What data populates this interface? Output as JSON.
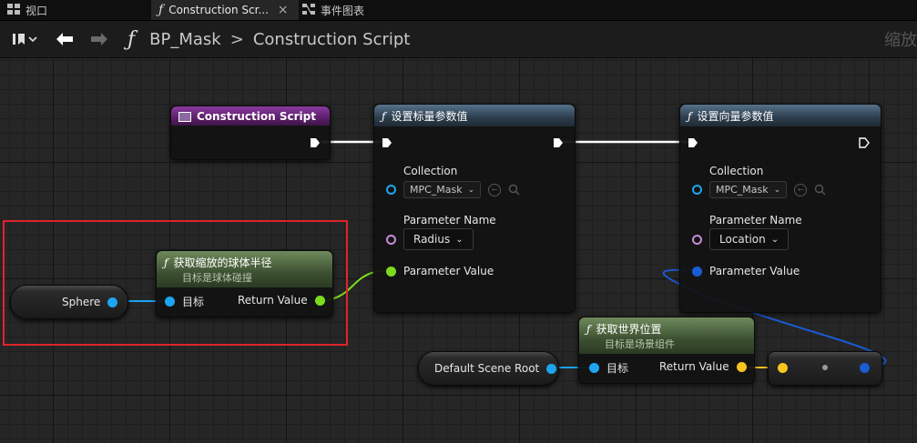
{
  "tabs": [
    {
      "label": "视口",
      "icon": "viewport-grid-icon"
    },
    {
      "label": "Construction Scr...",
      "icon": "function-icon",
      "close": "×"
    },
    {
      "label": "事件图表",
      "icon": "event-graph-icon"
    }
  ],
  "toolbar": {
    "breadcrumb_blueprint": "BP_Mask",
    "breadcrumb_separator": ">",
    "breadcrumb_graph": "Construction Script",
    "zoom_label": "缩放"
  },
  "nodes": {
    "construction_script": {
      "title": "Construction Script"
    },
    "set_scalar": {
      "title": "设置标量参数值",
      "collection_label": "Collection",
      "collection_value": "MPC_Mask",
      "param_name_label": "Parameter Name",
      "param_name_value": "Radius",
      "param_value_label": "Parameter Value"
    },
    "set_vector": {
      "title": "设置向量参数值",
      "collection_label": "Collection",
      "collection_value": "MPC_Mask",
      "param_name_label": "Parameter Name",
      "param_name_value": "Location",
      "param_value_label": "Parameter Value"
    },
    "get_scaled_radius": {
      "title": "获取缩放的球体半径",
      "subtitle": "目标是球体碰撞",
      "target_label": "目标",
      "return_label": "Return Value"
    },
    "get_world_location": {
      "title": "获取世界位置",
      "subtitle": "目标是场景组件",
      "target_label": "目标",
      "return_label": "Return Value"
    },
    "sphere_var": {
      "label": "Sphere"
    },
    "scene_root_var": {
      "label": "Default Scene Root"
    }
  },
  "colors": {
    "exec": "#ffffff",
    "object_pin": "#1da5f2",
    "float_pin": "#7ddb1b",
    "vector_pin": "#f7c51f",
    "linear_color_pin": "#1a5bd6",
    "name_pin": "#c48cd9",
    "selection_box": "#e0242b"
  }
}
